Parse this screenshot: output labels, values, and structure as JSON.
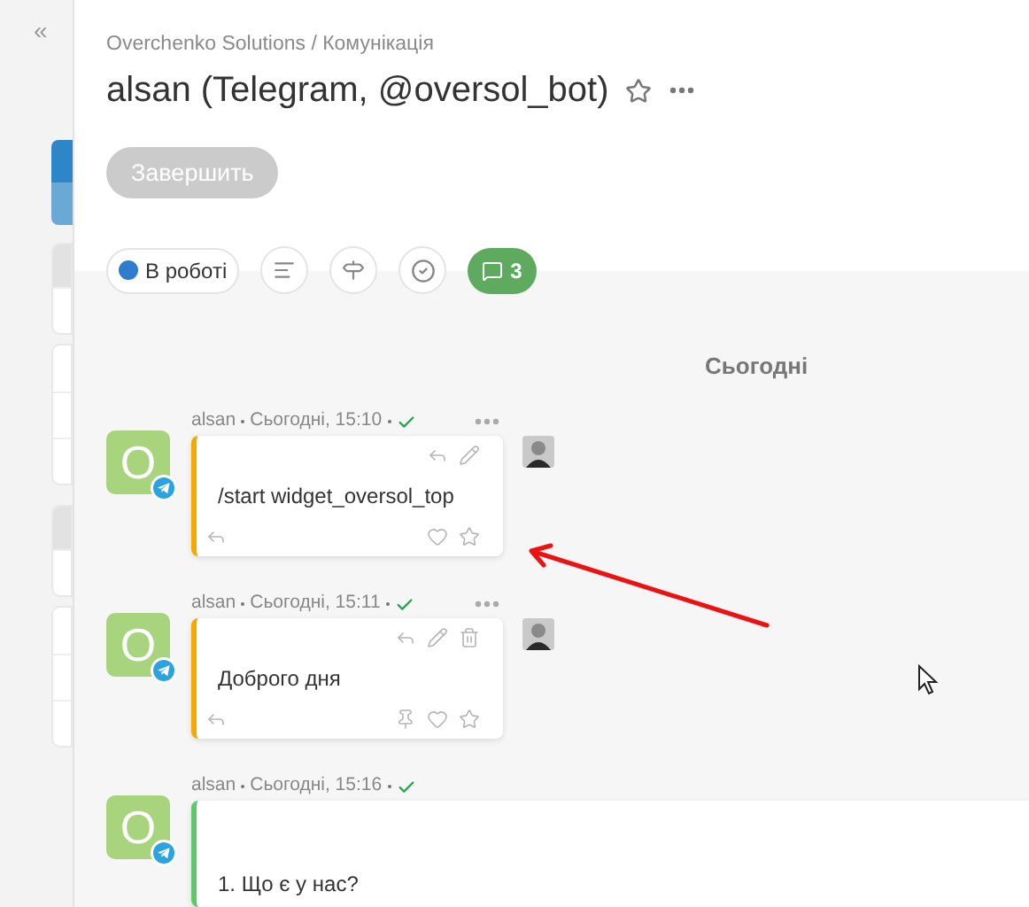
{
  "sidebar": {
    "collapse_label": "«",
    "tabs": [
      {
        "selected": true
      },
      {
        "selected": false,
        "kind": "header"
      },
      {
        "selected": false,
        "kind": "list"
      },
      {
        "selected": false,
        "kind": "header"
      },
      {
        "selected": false,
        "kind": "list"
      }
    ]
  },
  "header": {
    "breadcrumb": "Overchenko Solutions / Комунікація",
    "title": "alsan (Telegram, @oversol_bot)",
    "favorite": false
  },
  "finish_button": {
    "label": "Завершить",
    "disabled": true
  },
  "toolbar": {
    "status": {
      "label": "В роботі",
      "color": "#2f7bd0"
    },
    "comments_count": "3"
  },
  "date_divider": "Сьогодні",
  "messages": [
    {
      "avatar_letter": "O",
      "author": "alsan",
      "time": "Сьогодні, 15:10",
      "delivered": true,
      "menu": true,
      "reviewed": true,
      "wide": false,
      "color": "#f5a800",
      "text": "/start widget_oversol_top",
      "actions": true,
      "deletable": false,
      "pinnable": false
    },
    {
      "avatar_letter": "O",
      "author": "alsan",
      "time": "Сьогодні, 15:11",
      "delivered": true,
      "menu": true,
      "reviewed": true,
      "wide": false,
      "color": "#f5a800",
      "text": "Доброго дня",
      "actions": true,
      "deletable": true,
      "pinnable": true
    },
    {
      "avatar_letter": "O",
      "author": "alsan",
      "time": "Сьогодні, 15:16",
      "delivered": true,
      "menu": false,
      "reviewed": false,
      "wide": true,
      "color": "#5cc96b",
      "text": "1. Що є у нас?",
      "actions": false,
      "deletable": false,
      "pinnable": false
    }
  ]
}
